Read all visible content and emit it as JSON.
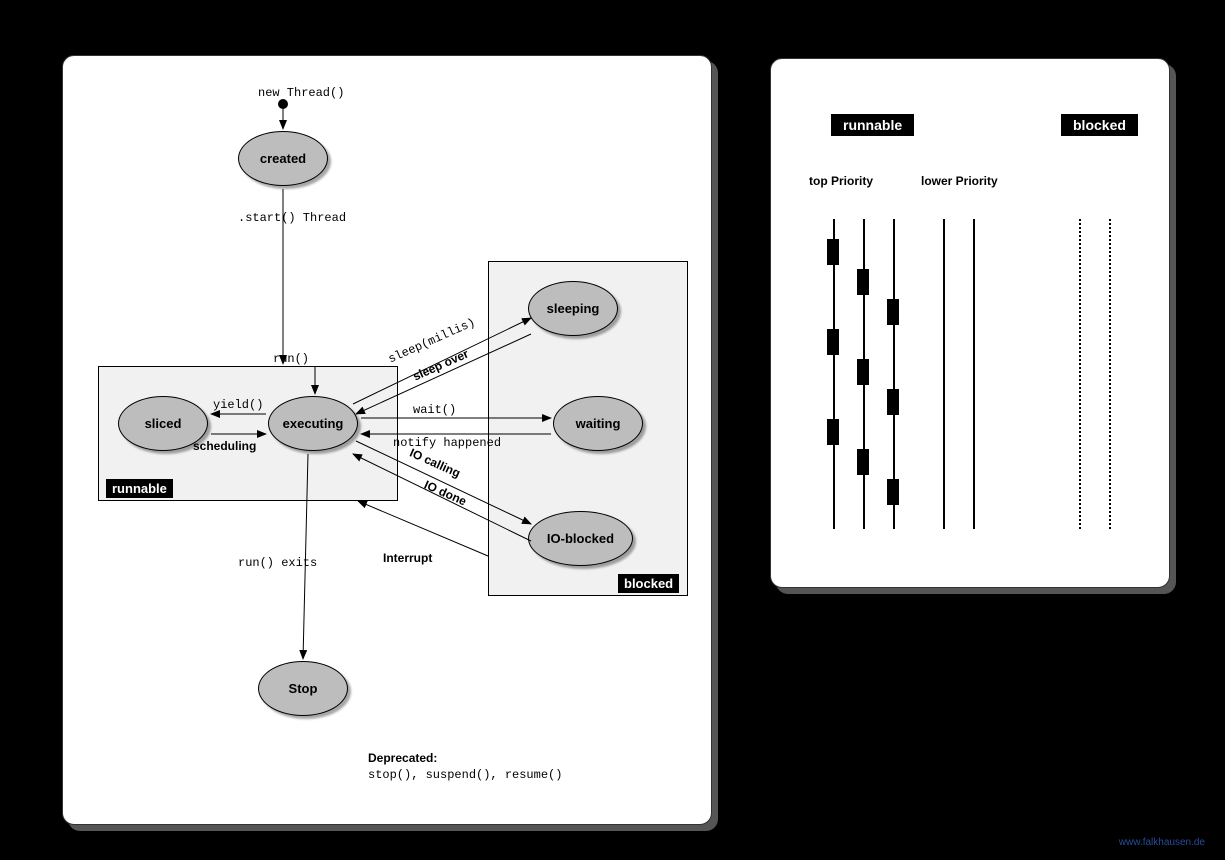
{
  "left": {
    "top_creation_label": "new Thread()",
    "states": {
      "created": "created",
      "sliced": "sliced",
      "executing": "executing",
      "sleeping": "sleeping",
      "waiting": "waiting",
      "io_blocked": "IO-blocked",
      "stop": "Stop"
    },
    "regions": {
      "runnable": "runnable",
      "blocked": "blocked"
    },
    "edges": {
      "start_thread": ".start() Thread",
      "run": "run()",
      "yield": "yield()",
      "scheduling": "scheduling",
      "sleep_millis": "sleep(millis)",
      "sleep_over": "sleep over",
      "wait": "wait()",
      "notify_happened": "notify happened",
      "io_calling": "IO calling",
      "io_done": "IO done",
      "interrupt": "Interrupt",
      "run_exits": "run() exits"
    },
    "deprecated_title": "Deprecated:",
    "deprecated_body": "stop(), suspend(), resume()"
  },
  "right": {
    "badges": {
      "runnable": "runnable",
      "blocked": "blocked"
    },
    "priority_labels": {
      "top": "top Priority",
      "lower": "lower Priority"
    }
  },
  "footer": "www.falkhausen.de"
}
